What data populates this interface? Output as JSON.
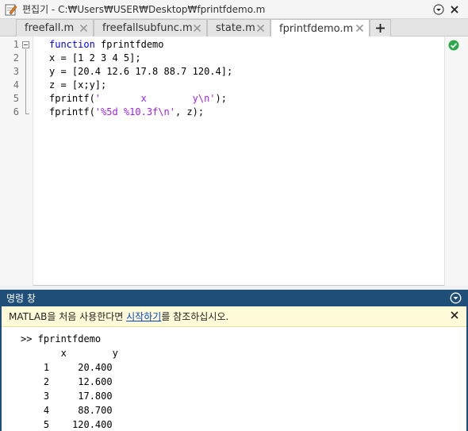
{
  "window": {
    "title": "편집기 - C:₩Users₩USER₩Desktop₩fprintfdemo.m"
  },
  "tabs": [
    {
      "label": "freefall.m",
      "active": false
    },
    {
      "label": "freefallsubfunc.m",
      "active": false
    },
    {
      "label": "state.m",
      "active": false
    },
    {
      "label": "fprintfdemo.m",
      "active": true
    }
  ],
  "editor": {
    "line_numbers": [
      "1",
      "2",
      "3",
      "4",
      "5",
      "6"
    ],
    "lines": [
      {
        "keyword": "function",
        "rest": " fprintfdemo"
      },
      {
        "text": "x = [1 2 3 4 5];"
      },
      {
        "text": "y = [20.4 12.6 17.8 88.7 120.4];"
      },
      {
        "text": "z = [x;y];"
      },
      {
        "pre": "fprintf(",
        "str": "'       x        y\\n'",
        "post": ");"
      },
      {
        "pre": "fprintf(",
        "str": "'%5d %10.3f\\n'",
        "post": ", z);"
      }
    ],
    "status_icon": "check-circle-icon",
    "status_color": "#2ea84a"
  },
  "command_window": {
    "title": "명령 창",
    "notice": {
      "before": "MATLAB을 처음 사용한다면 ",
      "link": "시작하기",
      "after": "를 참조하십시오."
    },
    "output": [
      ">> fprintfdemo",
      "       x        y",
      "    1     20.400",
      "    2     12.600",
      "    3     17.800",
      "    4     88.700",
      "    5    120.400"
    ]
  },
  "colors": {
    "keyword": "#0000ff",
    "string": "#a020f0",
    "command_header": "#1f4e79",
    "notice_bg": "#fffbd8"
  }
}
